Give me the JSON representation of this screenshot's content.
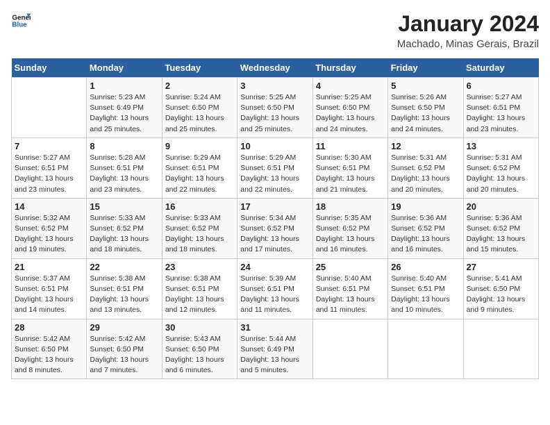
{
  "logo": {
    "line1": "General",
    "line2": "Blue"
  },
  "title": "January 2024",
  "subtitle": "Machado, Minas Gerais, Brazil",
  "days_header": [
    "Sunday",
    "Monday",
    "Tuesday",
    "Wednesday",
    "Thursday",
    "Friday",
    "Saturday"
  ],
  "weeks": [
    [
      {
        "num": "",
        "info": ""
      },
      {
        "num": "1",
        "info": "Sunrise: 5:23 AM\nSunset: 6:49 PM\nDaylight: 13 hours\nand 25 minutes."
      },
      {
        "num": "2",
        "info": "Sunrise: 5:24 AM\nSunset: 6:50 PM\nDaylight: 13 hours\nand 25 minutes."
      },
      {
        "num": "3",
        "info": "Sunrise: 5:25 AM\nSunset: 6:50 PM\nDaylight: 13 hours\nand 25 minutes."
      },
      {
        "num": "4",
        "info": "Sunrise: 5:25 AM\nSunset: 6:50 PM\nDaylight: 13 hours\nand 24 minutes."
      },
      {
        "num": "5",
        "info": "Sunrise: 5:26 AM\nSunset: 6:50 PM\nDaylight: 13 hours\nand 24 minutes."
      },
      {
        "num": "6",
        "info": "Sunrise: 5:27 AM\nSunset: 6:51 PM\nDaylight: 13 hours\nand 23 minutes."
      }
    ],
    [
      {
        "num": "7",
        "info": "Sunrise: 5:27 AM\nSunset: 6:51 PM\nDaylight: 13 hours\nand 23 minutes."
      },
      {
        "num": "8",
        "info": "Sunrise: 5:28 AM\nSunset: 6:51 PM\nDaylight: 13 hours\nand 23 minutes."
      },
      {
        "num": "9",
        "info": "Sunrise: 5:29 AM\nSunset: 6:51 PM\nDaylight: 13 hours\nand 22 minutes."
      },
      {
        "num": "10",
        "info": "Sunrise: 5:29 AM\nSunset: 6:51 PM\nDaylight: 13 hours\nand 22 minutes."
      },
      {
        "num": "11",
        "info": "Sunrise: 5:30 AM\nSunset: 6:51 PM\nDaylight: 13 hours\nand 21 minutes."
      },
      {
        "num": "12",
        "info": "Sunrise: 5:31 AM\nSunset: 6:52 PM\nDaylight: 13 hours\nand 20 minutes."
      },
      {
        "num": "13",
        "info": "Sunrise: 5:31 AM\nSunset: 6:52 PM\nDaylight: 13 hours\nand 20 minutes."
      }
    ],
    [
      {
        "num": "14",
        "info": "Sunrise: 5:32 AM\nSunset: 6:52 PM\nDaylight: 13 hours\nand 19 minutes."
      },
      {
        "num": "15",
        "info": "Sunrise: 5:33 AM\nSunset: 6:52 PM\nDaylight: 13 hours\nand 18 minutes."
      },
      {
        "num": "16",
        "info": "Sunrise: 5:33 AM\nSunset: 6:52 PM\nDaylight: 13 hours\nand 18 minutes."
      },
      {
        "num": "17",
        "info": "Sunrise: 5:34 AM\nSunset: 6:52 PM\nDaylight: 13 hours\nand 17 minutes."
      },
      {
        "num": "18",
        "info": "Sunrise: 5:35 AM\nSunset: 6:52 PM\nDaylight: 13 hours\nand 16 minutes."
      },
      {
        "num": "19",
        "info": "Sunrise: 5:36 AM\nSunset: 6:52 PM\nDaylight: 13 hours\nand 16 minutes."
      },
      {
        "num": "20",
        "info": "Sunrise: 5:36 AM\nSunset: 6:52 PM\nDaylight: 13 hours\nand 15 minutes."
      }
    ],
    [
      {
        "num": "21",
        "info": "Sunrise: 5:37 AM\nSunset: 6:51 PM\nDaylight: 13 hours\nand 14 minutes."
      },
      {
        "num": "22",
        "info": "Sunrise: 5:38 AM\nSunset: 6:51 PM\nDaylight: 13 hours\nand 13 minutes."
      },
      {
        "num": "23",
        "info": "Sunrise: 5:38 AM\nSunset: 6:51 PM\nDaylight: 13 hours\nand 12 minutes."
      },
      {
        "num": "24",
        "info": "Sunrise: 5:39 AM\nSunset: 6:51 PM\nDaylight: 13 hours\nand 11 minutes."
      },
      {
        "num": "25",
        "info": "Sunrise: 5:40 AM\nSunset: 6:51 PM\nDaylight: 13 hours\nand 11 minutes."
      },
      {
        "num": "26",
        "info": "Sunrise: 5:40 AM\nSunset: 6:51 PM\nDaylight: 13 hours\nand 10 minutes."
      },
      {
        "num": "27",
        "info": "Sunrise: 5:41 AM\nSunset: 6:50 PM\nDaylight: 13 hours\nand 9 minutes."
      }
    ],
    [
      {
        "num": "28",
        "info": "Sunrise: 5:42 AM\nSunset: 6:50 PM\nDaylight: 13 hours\nand 8 minutes."
      },
      {
        "num": "29",
        "info": "Sunrise: 5:42 AM\nSunset: 6:50 PM\nDaylight: 13 hours\nand 7 minutes."
      },
      {
        "num": "30",
        "info": "Sunrise: 5:43 AM\nSunset: 6:50 PM\nDaylight: 13 hours\nand 6 minutes."
      },
      {
        "num": "31",
        "info": "Sunrise: 5:44 AM\nSunset: 6:49 PM\nDaylight: 13 hours\nand 5 minutes."
      },
      {
        "num": "",
        "info": ""
      },
      {
        "num": "",
        "info": ""
      },
      {
        "num": "",
        "info": ""
      }
    ]
  ]
}
